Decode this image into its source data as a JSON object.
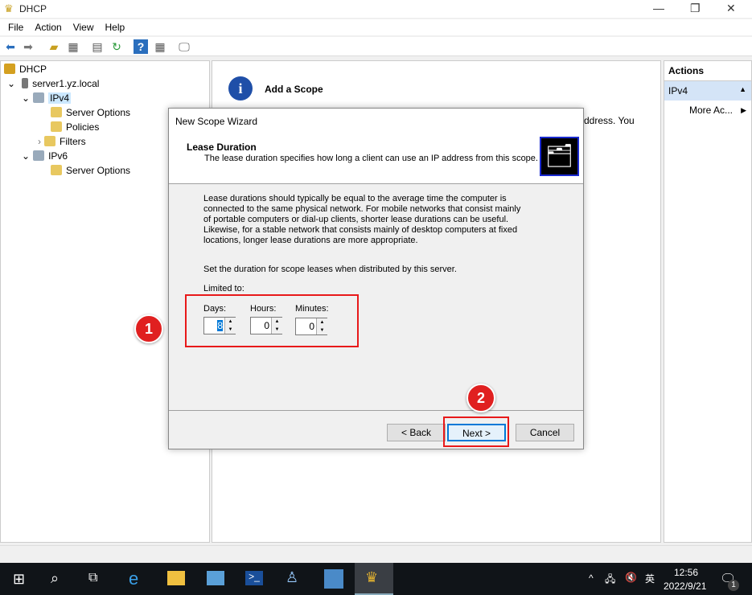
{
  "window": {
    "title": "DHCP"
  },
  "menu": [
    "File",
    "Action",
    "View",
    "Help"
  ],
  "tree": {
    "root": "DHCP",
    "server": "server1.yz.local",
    "ipv4": "IPv4",
    "ipv4_children": [
      "Server Options",
      "Policies",
      "Filters"
    ],
    "ipv6": "IPv6",
    "ipv6_children": [
      "Server Options"
    ]
  },
  "middle": {
    "heading": "Add a Scope",
    "partial_text": "ddress. You"
  },
  "actions": {
    "title": "Actions",
    "section": "IPv4",
    "more": "More Ac..."
  },
  "dialog": {
    "title": "New Scope Wizard",
    "header_title": "Lease Duration",
    "header_subtitle": "The lease duration specifies how long a client can use an IP address from this scope.",
    "body": "Lease durations should typically be equal to the average time the computer is connected to the same physical network. For mobile networks that consist mainly of portable computers or dial-up clients, shorter lease durations can be useful. Likewise, for a stable network that consists mainly of desktop computers at fixed locations, longer lease durations are more appropriate.",
    "set_text": "Set the duration for scope leases when distributed by this server.",
    "limited": "Limited to:",
    "days_label": "Days:",
    "days": "8",
    "hours_label": "Hours:",
    "hours": "0",
    "minutes_label": "Minutes:",
    "minutes": "0",
    "back": "< Back",
    "next": "Next >",
    "cancel": "Cancel"
  },
  "callouts": [
    "1",
    "2"
  ],
  "taskbar": {
    "time": "12:56",
    "date": "2022/9/21",
    "ime": "英",
    "notifications": "1"
  }
}
